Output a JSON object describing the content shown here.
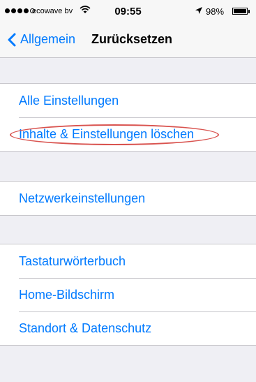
{
  "status_bar": {
    "carrier": "ecowave bv",
    "time": "09:55",
    "battery_percent": "98%",
    "signal_bars_filled": 4,
    "signal_bars_total": 5,
    "battery_level": 0.98,
    "icons": [
      "wifi-icon",
      "location-arrow-icon",
      "battery-icon"
    ]
  },
  "nav": {
    "back_label": "Allgemein",
    "title": "Zurücksetzen"
  },
  "groups": [
    {
      "items": [
        {
          "label": "Alle Einstellungen"
        },
        {
          "label": "Inhalte & Einstellungen löschen",
          "annotated": true
        }
      ]
    },
    {
      "items": [
        {
          "label": "Netzwerkeinstellungen"
        }
      ]
    },
    {
      "items": [
        {
          "label": "Tastaturwörterbuch"
        },
        {
          "label": "Home-Bildschirm"
        },
        {
          "label": "Standort & Datenschutz"
        }
      ]
    }
  ],
  "colors": {
    "accent": "#007aff",
    "background": "#efeff4",
    "annotation": "#d9534f"
  }
}
